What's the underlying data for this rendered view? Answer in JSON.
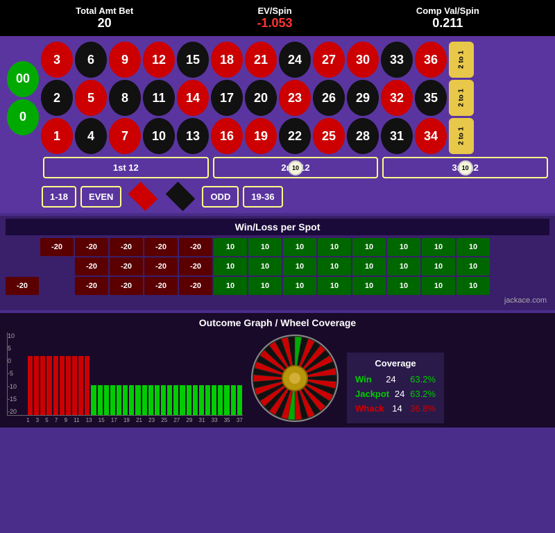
{
  "header": {
    "total_amt_bet_label": "Total Amt Bet",
    "total_amt_bet_value": "20",
    "ev_spin_label": "EV/Spin",
    "ev_spin_value": "-1.053",
    "comp_val_spin_label": "Comp Val/Spin",
    "comp_val_spin_value": "0.211"
  },
  "roulette": {
    "zero": "0",
    "double_zero": "00",
    "rows": [
      [
        {
          "n": "3",
          "c": "red"
        },
        {
          "n": "6",
          "c": "black"
        },
        {
          "n": "9",
          "c": "red"
        },
        {
          "n": "12",
          "c": "red"
        },
        {
          "n": "15",
          "c": "black"
        },
        {
          "n": "18",
          "c": "red"
        },
        {
          "n": "21",
          "c": "red"
        },
        {
          "n": "24",
          "c": "black"
        },
        {
          "n": "27",
          "c": "red"
        },
        {
          "n": "30",
          "c": "red"
        },
        {
          "n": "33",
          "c": "black"
        },
        {
          "n": "36",
          "c": "red"
        }
      ],
      [
        {
          "n": "2",
          "c": "black"
        },
        {
          "n": "5",
          "c": "red"
        },
        {
          "n": "8",
          "c": "black"
        },
        {
          "n": "11",
          "c": "black"
        },
        {
          "n": "14",
          "c": "red"
        },
        {
          "n": "17",
          "c": "black"
        },
        {
          "n": "20",
          "c": "black"
        },
        {
          "n": "23",
          "c": "red"
        },
        {
          "n": "26",
          "c": "black"
        },
        {
          "n": "29",
          "c": "black"
        },
        {
          "n": "32",
          "c": "red"
        },
        {
          "n": "35",
          "c": "black"
        }
      ],
      [
        {
          "n": "1",
          "c": "red"
        },
        {
          "n": "4",
          "c": "black"
        },
        {
          "n": "7",
          "c": "red"
        },
        {
          "n": "10",
          "c": "black"
        },
        {
          "n": "13",
          "c": "black"
        },
        {
          "n": "16",
          "c": "red"
        },
        {
          "n": "19",
          "c": "red"
        },
        {
          "n": "22",
          "c": "black"
        },
        {
          "n": "25",
          "c": "red"
        },
        {
          "n": "28",
          "c": "black"
        },
        {
          "n": "31",
          "c": "black"
        },
        {
          "n": "34",
          "c": "red"
        }
      ]
    ],
    "payouts": [
      "2 to 1",
      "2 to 1",
      "2 to 1"
    ],
    "dozen1": "1st 12",
    "dozen2": "2nd 12",
    "dozen3": "3rd 12",
    "bet_118": "1-18",
    "bet_even": "EVEN",
    "bet_odd": "ODD",
    "bet_1936": "19-36",
    "chip_value": "10"
  },
  "win_loss": {
    "title": "Win/Loss per Spot",
    "rows": [
      [
        "-20",
        "-20",
        "-20",
        "-20",
        "-20",
        "10",
        "10",
        "10",
        "10",
        "10",
        "10",
        "10",
        "10"
      ],
      [
        "",
        "",
        "-20",
        "-20",
        "-20",
        "-20",
        "10",
        "10",
        "10",
        "10",
        "10",
        "10",
        "10",
        "10"
      ],
      [
        "-20",
        "",
        "-20",
        "-20",
        "-20",
        "-20",
        "10",
        "10",
        "10",
        "10",
        "10",
        "10",
        "10",
        "10"
      ]
    ]
  },
  "credit": "jackace.com",
  "outcome": {
    "title": "Outcome Graph / Wheel Coverage",
    "y_labels": [
      "10",
      "5",
      "0",
      "-5",
      "-10",
      "-15",
      "-20"
    ],
    "x_labels": [
      "1",
      "3",
      "5",
      "7",
      "9",
      "11",
      "13",
      "15",
      "17",
      "19",
      "21",
      "23",
      "25",
      "27",
      "29",
      "31",
      "33",
      "35",
      "37"
    ],
    "neg_bars_count": 10,
    "pos_bars_count": 24,
    "coverage": {
      "title": "Coverage",
      "win_label": "Win",
      "win_count": "24",
      "win_pct": "63.2%",
      "jackpot_label": "Jackpot",
      "jackpot_count": "24",
      "jackpot_pct": "63.2%",
      "whack_label": "Whack",
      "whack_count": "14",
      "whack_pct": "36.8%"
    }
  }
}
